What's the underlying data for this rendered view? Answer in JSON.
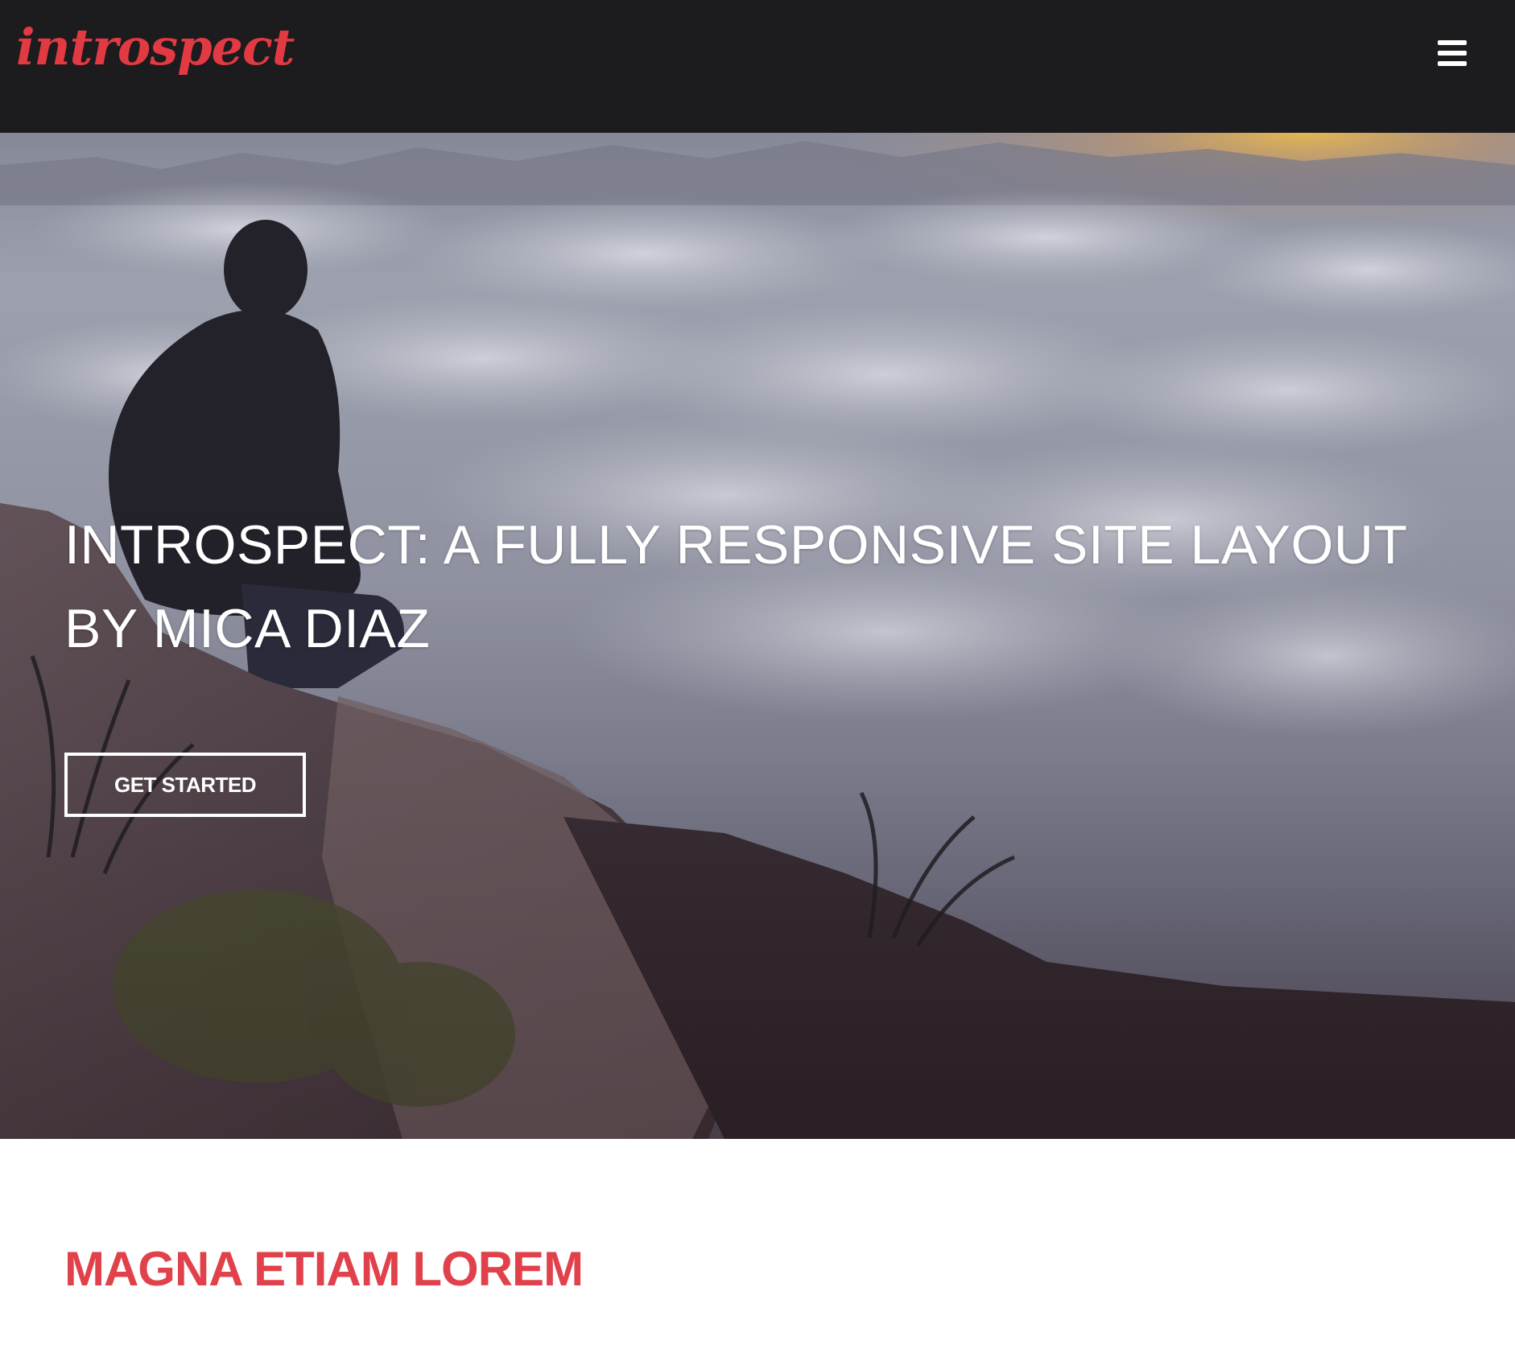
{
  "header": {
    "logo_text": "introspect",
    "menu_icon": "hamburger-menu-icon",
    "logo_color": "#e23a43",
    "background_color": "#1c1b1d"
  },
  "hero": {
    "title": "INTROSPECT: A FULLY RESPONSIVE SITE LAYOUT BY MICA DIAZ",
    "cta_label": "GET STARTED"
  },
  "section": {
    "title": "MAGNA ETIAM LOREM",
    "title_color": "#e1414a"
  }
}
